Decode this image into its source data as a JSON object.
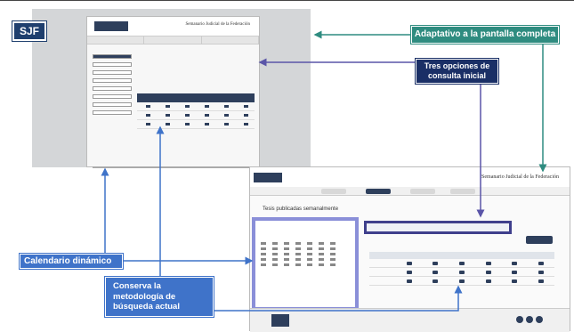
{
  "badge": "SJF",
  "callouts": {
    "fullscreen": "Adaptativo a la pantalla completa",
    "three_options": "Tres opciones de consulta inicial",
    "calendar": "Calendario dinámico",
    "methodology": "Conserva la metodología de búsqueda actual"
  },
  "old_screenshot": {
    "header_title": "Semanario Judicial de la Federación"
  },
  "new_screenshot": {
    "header_title": "Semanario Judicial de la Federación",
    "subtitle": "Tesis publicadas semanalmente"
  },
  "colors": {
    "teal": "#2f8c80",
    "navy": "#1a2f66",
    "blue": "#3f73c9",
    "calendar_border": "#8a8fd8",
    "arrow_purple": "#5a55a8",
    "brand": "#2e3f5c"
  }
}
